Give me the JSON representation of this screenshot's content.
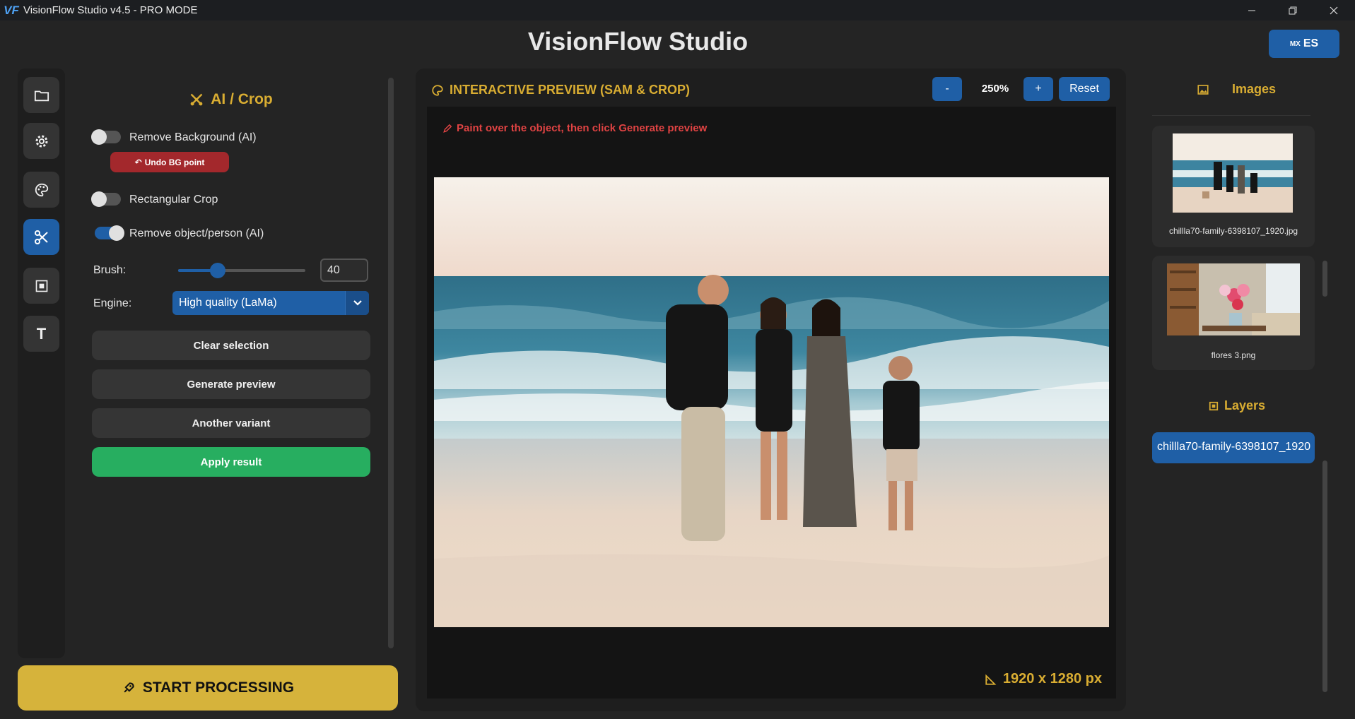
{
  "window": {
    "title": "VisionFlow Studio v4.5 - PRO MODE",
    "logo": "VF"
  },
  "header": {
    "app_title": "VisionFlow Studio",
    "lang_flag": "MX",
    "lang_label": "ES"
  },
  "rail": {
    "items": [
      "folder-icon",
      "gear-icon",
      "palette-icon",
      "scissors-icon",
      "frame-icon",
      "text-icon"
    ],
    "active": "scissors-icon",
    "text_glyph": "T"
  },
  "left_panel": {
    "title": "AI / Crop",
    "remove_bg_label": "Remove Background (AI)",
    "remove_bg_on": false,
    "undo_bg_label": "Undo BG point",
    "rect_crop_label": "Rectangular Crop",
    "rect_crop_on": false,
    "remove_object_label": "Remove object/person (AI)",
    "remove_object_on": true,
    "brush_label": "Brush:",
    "brush_value": "40",
    "brush_fraction": 0.31,
    "engine_label": "Engine:",
    "engine_value": "High quality (LaMa)",
    "buttons": {
      "clear": "Clear selection",
      "generate": "Generate preview",
      "variant": "Another variant",
      "apply": "Apply result"
    }
  },
  "start_button": "START PROCESSING",
  "preview": {
    "title": "INTERACTIVE PREVIEW (SAM & CROP)",
    "zoom_out": "-",
    "zoom_value": "250%",
    "zoom_in": "+",
    "reset": "Reset",
    "hint": "Paint over the object, then click Generate preview",
    "dimensions": "1920 x 1280 px"
  },
  "right_panel": {
    "images_title": "Images",
    "images": [
      {
        "name": "chillla70-family-6398107_1920.jpg"
      },
      {
        "name": "flores 3.png"
      }
    ],
    "layers_title": "Layers",
    "layers": [
      "chillla70-family-6398107_1920"
    ]
  },
  "colors": {
    "accent_blue": "#1f5fa6",
    "accent_gold": "#d9ad32",
    "hint_red": "#e04343",
    "apply_green": "#27ae60"
  }
}
